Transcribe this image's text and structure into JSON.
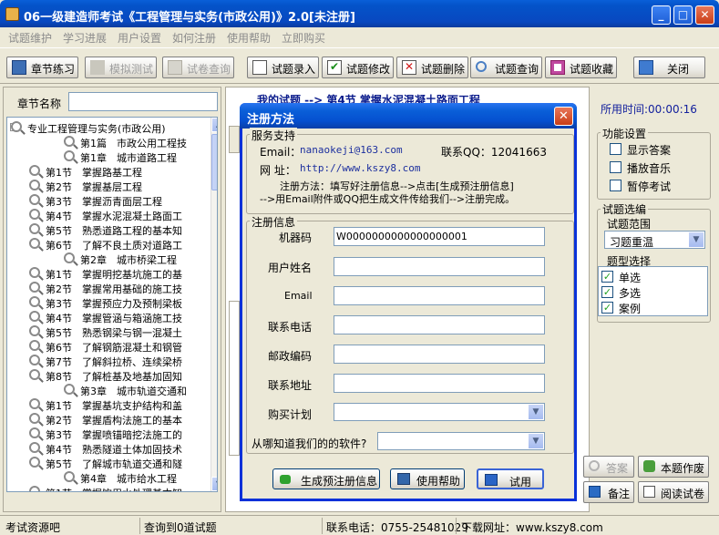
{
  "window": {
    "title": "06一级建造师考试《工程管理与实务(市政公用)》2.0[未注册]"
  },
  "menu": [
    "试题维护",
    "学习进展",
    "用户设置",
    "如何注册",
    "使用帮助",
    "立即购买"
  ],
  "toolbar": {
    "chapter": "章节练习",
    "mock": "模拟测试",
    "paper": "试卷查询",
    "entry": "试题录入",
    "modify": "试题修改",
    "delete": "试题删除",
    "query": "试题查询",
    "favorite": "试题收藏",
    "close": "关闭"
  },
  "left": {
    "section_label": "章节名称",
    "tree": [
      "专业工程管理与实务(市政公用)",
      "第1篇　市政公用工程技",
      "第1章　城市道路工程",
      "第1节　掌握路基工程",
      "第2节　掌握基层工程",
      "第3节　掌握沥青面层工程",
      "第4节　掌握水泥混凝土路面工",
      "第5节　熟悉道路工程的基本知",
      "第6节　了解不良土质对道路工",
      "第2章　城市桥梁工程",
      "第1节　掌握明挖基坑施工的基",
      "第2节　掌握常用基础的施工技",
      "第3节　掌握预应力及预制梁板",
      "第4节　掌握管涵与箱涵施工技",
      "第5节　熟悉钢梁与钢一混凝土",
      "第6节　了解钢筋混凝土和钢管",
      "第7节　了解斜拉桥、连续梁桥",
      "第8节　了解桩基及地基加固知",
      "第3章　城市轨道交通和",
      "第1节　掌握基坑支护结构和盖",
      "第2节　掌握盾构法施工的基本",
      "第3节　掌握喷锚暗挖法施工的",
      "第4节　熟悉隧道土体加固技术",
      "第5节　了解城市轨道交通和隧",
      "第4章　城市给水工程",
      "第1节　掌握饮用水处理基本知"
    ]
  },
  "main": {
    "breadcrumb": "我的试题 --> 第4节 掌握水泥混凝土路面工程",
    "time_label": "所用时间:00:00:16"
  },
  "right": {
    "func_title": "功能设置",
    "show_answer": "显示答案",
    "play_music": "播放音乐",
    "pause_exam": "暂停考试",
    "select_title": "试题选编",
    "range_label": "试题范围",
    "range_value": "习题重温",
    "type_title": "题型选择",
    "types": [
      "单选",
      "多选",
      "案例"
    ],
    "answer_btn": "答案",
    "homework_btn": "本题作废",
    "note_btn": "备注",
    "read_btn": "阅读试卷"
  },
  "status": {
    "left": "考试资源吧",
    "mid": "查询到0道试题",
    "phone": "联系电话：0755-25481029",
    "url": "下载网址：www.kszy8.com"
  },
  "dialog": {
    "title": "注册方法",
    "service_title": "服务支持",
    "email_label": "Email：",
    "email": "nanaokeji@163.com",
    "qq": "联系QQ：12041663",
    "site_label": "网 址：",
    "site": "http://www.kszy8.com",
    "method1": "注册方法：填写好注册信息-->点击[生成预注册信息]",
    "method2": "-->用Email附件或QQ把生成文件传给我们-->注册完成。",
    "info_title": "注册信息",
    "machine_label": "机器码",
    "machine_value": "W0000000000000000001",
    "user_label": "用户姓名",
    "email_field_label": "Email",
    "phone_label": "联系电话",
    "zip_label": "邮政编码",
    "addr_label": "联系地址",
    "plan_label": "购买计划",
    "source_label": "从哪知道我们的的软件?",
    "gen_btn": "生成预注册信息",
    "help_btn": "使用帮助",
    "trial_btn": "试用"
  }
}
